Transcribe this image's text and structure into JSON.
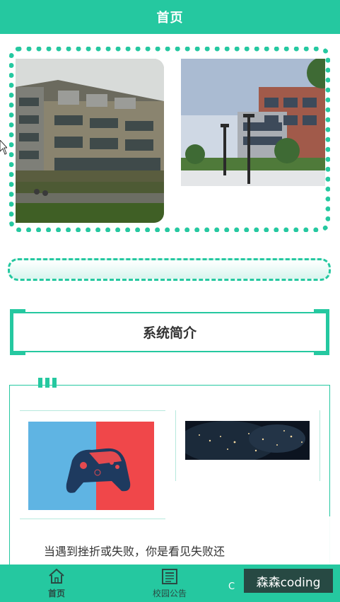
{
  "header": {
    "title": "首页"
  },
  "carousel": {
    "slides": [
      {
        "image": "villa-townhouses-photo"
      },
      {
        "image": "campus-building-photo"
      }
    ]
  },
  "section": {
    "title": "系统简介"
  },
  "intro": {
    "images": [
      "game-controller-image",
      "night-earth-image"
    ],
    "text": "当遇到挫折或失败，你是看见失败还"
  },
  "tabbar": {
    "items": [
      {
        "label": "首页",
        "icon": "home-icon",
        "active": true
      },
      {
        "label": "校园公告",
        "icon": "newspaper-icon",
        "active": false
      },
      {
        "label": "",
        "icon": "",
        "active": false
      }
    ]
  },
  "watermark": {
    "text": "森森coding",
    "prefix": "C"
  },
  "colors": {
    "accent": "#25c8a0",
    "controller_bg_left": "#5fb4e3",
    "controller_bg_right": "#f0474a"
  }
}
